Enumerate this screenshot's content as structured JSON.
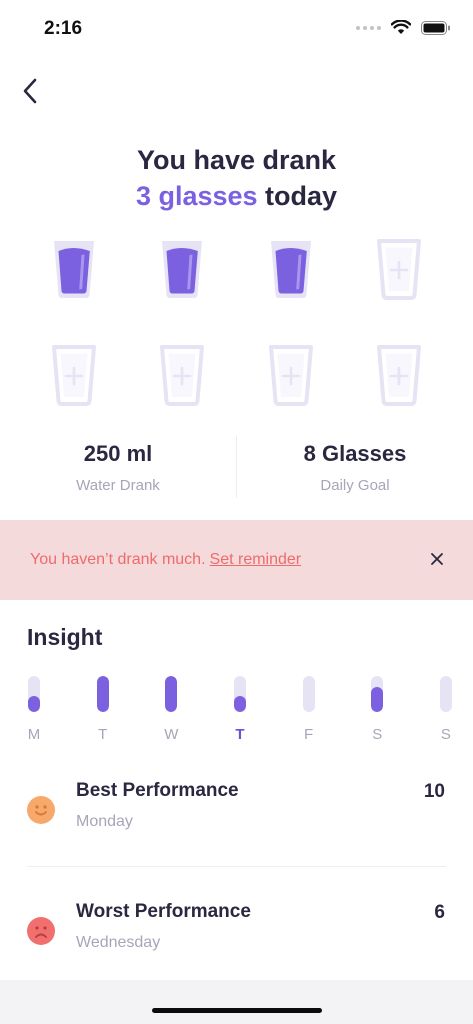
{
  "status": {
    "time": "2:16"
  },
  "header": {
    "line1": "You have drank",
    "highlight": "3 glasses",
    "line2_suffix": "today",
    "back_icon": "chevron-left-icon"
  },
  "glasses": {
    "filled": 3,
    "total": 8,
    "colors": {
      "filled": "#7b61e0",
      "empty": "#e6e3f4"
    }
  },
  "stats": [
    {
      "value": "250 ml",
      "label": "Water Drank"
    },
    {
      "value": "8 Glasses",
      "label": "Daily Goal"
    }
  ],
  "banner": {
    "message": "You haven’t drank much.",
    "link": "Set reminder",
    "close_icon": "close-icon",
    "background": "#f4dadb",
    "text_color": "#ef6b6b"
  },
  "insight": {
    "title": "Insight",
    "days": [
      {
        "label": "M",
        "level": 0.45,
        "active": false
      },
      {
        "label": "T",
        "level": 1.0,
        "active": false
      },
      {
        "label": "W",
        "level": 1.0,
        "active": false
      },
      {
        "label": "T",
        "level": 0.45,
        "active": true
      },
      {
        "label": "F",
        "level": 0.0,
        "active": false
      },
      {
        "label": "S",
        "level": 0.7,
        "active": false
      },
      {
        "label": "S",
        "level": 0.0,
        "active": false
      }
    ],
    "best": {
      "title": "Best Performance",
      "day": "Monday",
      "value": "10",
      "icon": "happy-face-icon",
      "color": "#f7a86b"
    },
    "worst": {
      "title": "Worst Performance",
      "day": "Wednesday",
      "value": "6",
      "icon": "sad-face-icon",
      "color": "#f26f6f"
    }
  }
}
